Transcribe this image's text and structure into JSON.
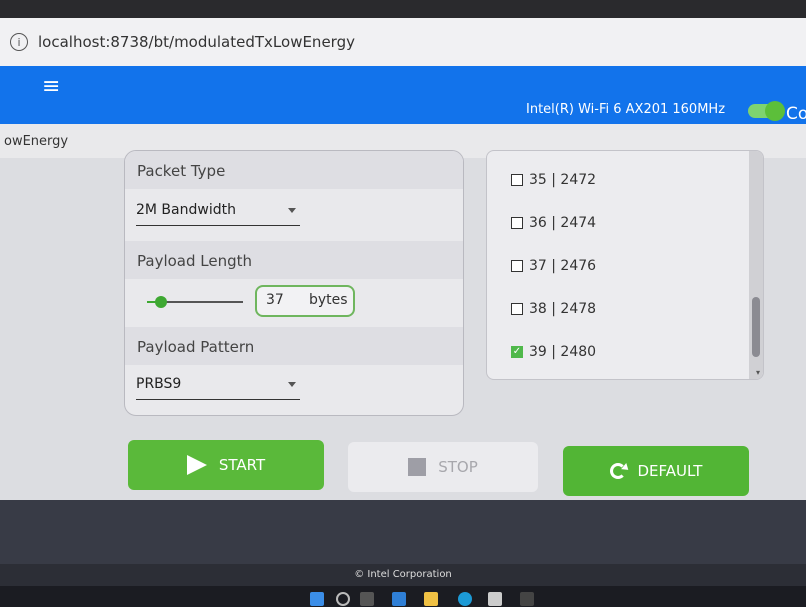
{
  "browser": {
    "url": "localhost:8738/bt/modulatedTxLowEnergy",
    "info_icon": "info-icon"
  },
  "header": {
    "menu_icon": "menu-icon",
    "adapter_name": "Intel(R) Wi-Fi 6 AX201 160MHz",
    "toggle_label_partial": "Co",
    "toggle_state": "on",
    "accent": "#1273eb"
  },
  "breadcrumb": {
    "text": "owEnergy"
  },
  "settings": {
    "packet_type_label": "Packet Type",
    "packet_type_value": "2M Bandwidth",
    "payload_length_label": "Payload Length",
    "payload_length_value": "37",
    "payload_length_unit": "bytes",
    "payload_length_slider_fraction": 0.15,
    "payload_pattern_label": "Payload Pattern",
    "payload_pattern_value": "PRBS9"
  },
  "channels": [
    {
      "label": "35 | 2472",
      "checked": false
    },
    {
      "label": "36 | 2474",
      "checked": false
    },
    {
      "label": "37 | 2476",
      "checked": false
    },
    {
      "label": "38 | 2478",
      "checked": false
    },
    {
      "label": "39 | 2480",
      "checked": true
    }
  ],
  "buttons": {
    "start_label": "START",
    "stop_label": "STOP",
    "default_label": "DEFAULT"
  },
  "footer": {
    "copyright": "© Intel Corporation"
  },
  "colors": {
    "green": "#5ab93a",
    "blue": "#1273eb"
  }
}
